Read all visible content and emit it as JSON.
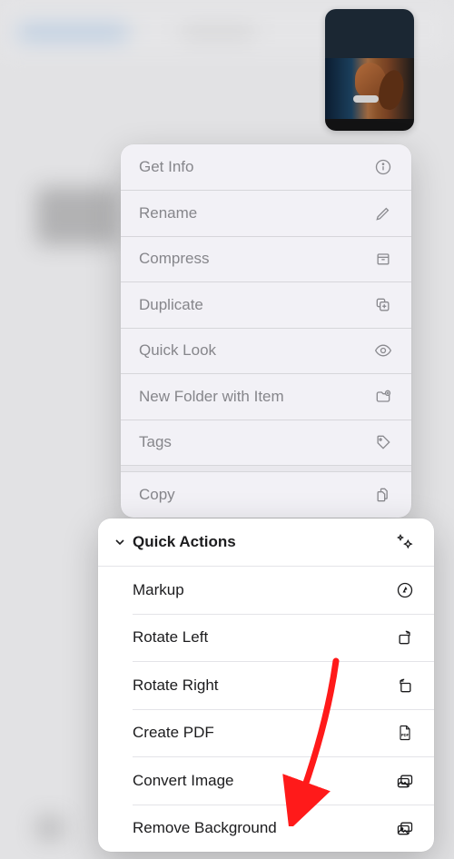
{
  "thumbnail": {
    "description": "photo-thumbnail-dog"
  },
  "menu": {
    "items": [
      {
        "label": "Get Info",
        "icon": "info-icon"
      },
      {
        "label": "Rename",
        "icon": "pencil-icon"
      },
      {
        "label": "Compress",
        "icon": "archive-icon"
      },
      {
        "label": "Duplicate",
        "icon": "duplicate-icon"
      },
      {
        "label": "Quick Look",
        "icon": "eye-icon"
      },
      {
        "label": "New Folder with Item",
        "icon": "new-folder-icon"
      },
      {
        "label": "Tags",
        "icon": "tag-icon"
      },
      {
        "label": "Copy",
        "icon": "copy-icon"
      }
    ]
  },
  "quick_actions": {
    "header": "Quick Actions",
    "header_icon": "sparkle-icon",
    "items": [
      {
        "label": "Markup",
        "icon": "markup-icon"
      },
      {
        "label": "Rotate Left",
        "icon": "rotate-left-icon"
      },
      {
        "label": "Rotate Right",
        "icon": "rotate-right-icon"
      },
      {
        "label": "Create PDF",
        "icon": "pdf-icon"
      },
      {
        "label": "Convert Image",
        "icon": "convert-image-icon"
      },
      {
        "label": "Remove Background",
        "icon": "remove-background-icon"
      }
    ]
  },
  "annotation": {
    "type": "red-arrow",
    "target": "remove-background"
  }
}
